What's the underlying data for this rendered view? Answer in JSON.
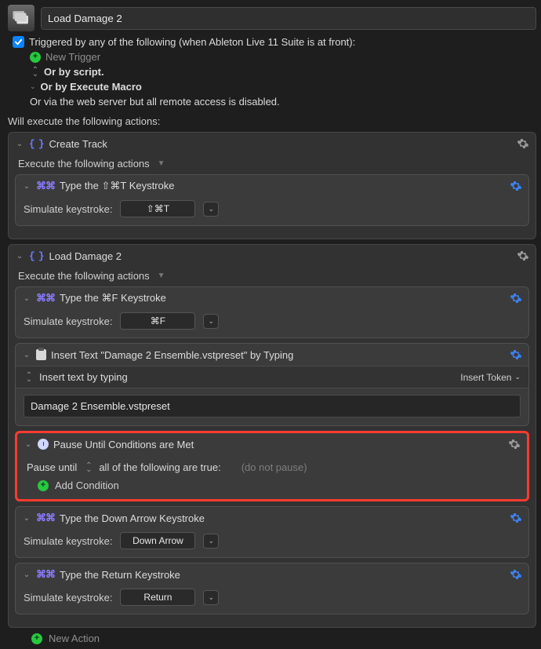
{
  "title": "Load Damage 2",
  "trigger_checked": true,
  "trigger_text": "Triggered by any of the following (when Ableton Live 11 Suite is at front):",
  "new_trigger": "New Trigger",
  "or_script": "Or by script.",
  "or_macro": "Or by Execute Macro",
  "or_web": "Or via the web server but all remote access is disabled.",
  "will_execute": "Will execute the following actions:",
  "exec_following": "Execute the following actions",
  "sim_label": "Simulate keystroke:",
  "group1": {
    "title": "Create Track",
    "action1": {
      "title": "Type the ⇧⌘T Keystroke",
      "key": "⇧⌘T"
    }
  },
  "group2": {
    "title": "Load Damage 2",
    "action1": {
      "title": "Type the ⌘F Keystroke",
      "key": "⌘F"
    },
    "action2": {
      "title": "Insert Text \"Damage 2 Ensemble.vstpreset\" by Typing",
      "bar_label": "Insert text by typing",
      "token": "Insert Token",
      "value": "Damage 2 Ensemble.vstpreset"
    },
    "action3": {
      "title": "Pause Until Conditions are Met",
      "pause_until": "Pause until",
      "all_true": "all of the following are true:",
      "hint": "(do not pause)",
      "add_condition": "Add Condition"
    },
    "action4": {
      "title": "Type the Down Arrow Keystroke",
      "key": "Down Arrow"
    },
    "action5": {
      "title": "Type the Return Keystroke",
      "key": "Return"
    }
  },
  "new_action": "New Action"
}
